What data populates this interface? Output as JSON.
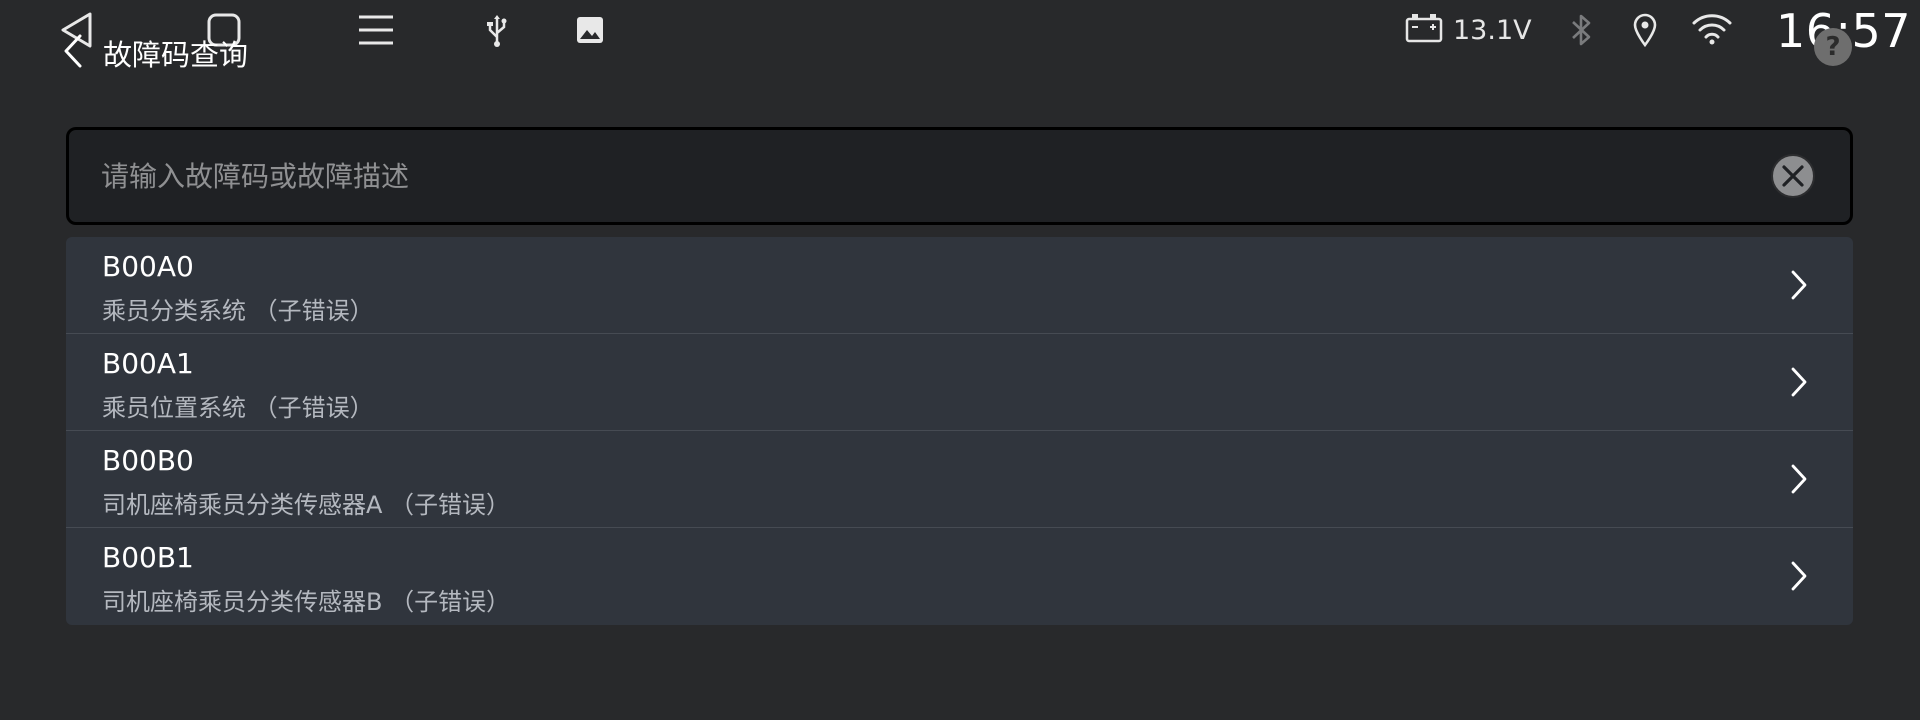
{
  "status_bar": {
    "nav_icons": [
      "back-triangle-icon",
      "home-square-icon",
      "menu-lines-icon",
      "usb-icon",
      "image-icon"
    ],
    "battery_voltage": "13.1V",
    "time": "16:57"
  },
  "header": {
    "title": "故障码查询"
  },
  "search": {
    "placeholder": "请输入故障码或故障描述",
    "value": ""
  },
  "results": [
    {
      "code": "B00A0",
      "description": "乘员分类系统 （子错误）"
    },
    {
      "code": "B00A1",
      "description": "乘员位置系统 （子错误）"
    },
    {
      "code": "B00B0",
      "description": "司机座椅乘员分类传感器A （子错误）"
    },
    {
      "code": "B00B1",
      "description": "司机座椅乘员分类传感器B （子错误）"
    }
  ],
  "colors": {
    "background": "#28292b",
    "list_background": "#30353d",
    "search_background": "#1f2124"
  }
}
